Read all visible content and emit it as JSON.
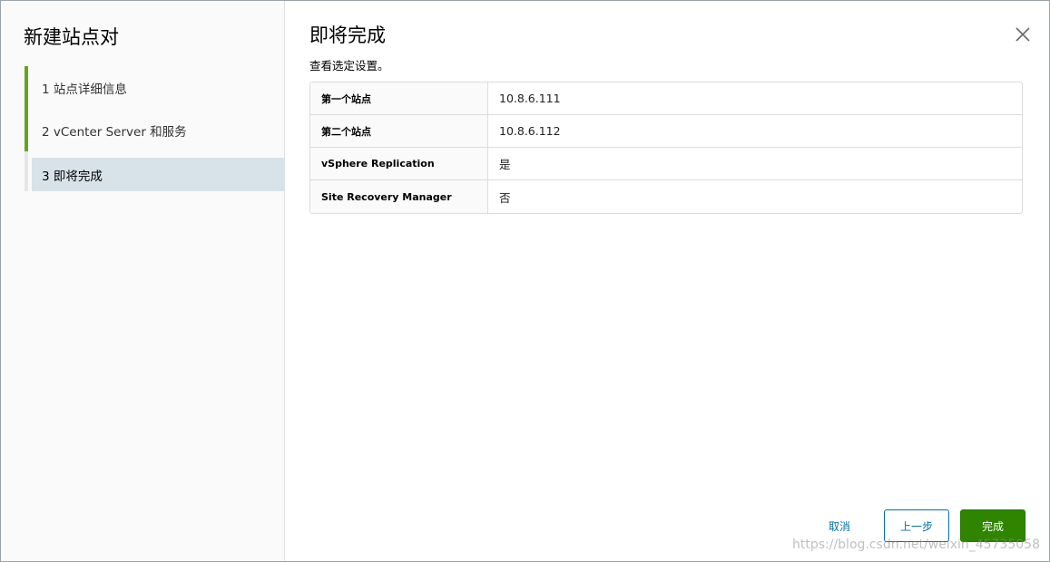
{
  "sidebar": {
    "title": "新建站点对",
    "steps": [
      {
        "label": "1  站点详细信息"
      },
      {
        "label": "2  vCenter Server 和服务"
      },
      {
        "label": "3  即将完成"
      }
    ]
  },
  "main": {
    "title": "即将完成",
    "subtitle": "查看选定设置。",
    "rows": [
      {
        "key": "第一个站点",
        "value": "10.8.6.111"
      },
      {
        "key": "第二个站点",
        "value": "10.8.6.112"
      },
      {
        "key": "vSphere Replication",
        "value": "是"
      },
      {
        "key": "Site Recovery Manager",
        "value": "否"
      }
    ]
  },
  "footer": {
    "cancel_label": "取消",
    "back_label": "上一步",
    "finish_label": "完成"
  },
  "watermark": "https://blog.csdn.net/weixin_45735058",
  "colors": {
    "accent": "#62a420",
    "primary_button": "#2f8400",
    "link": "#0072a3",
    "active_step_bg": "#d8e3e9"
  }
}
